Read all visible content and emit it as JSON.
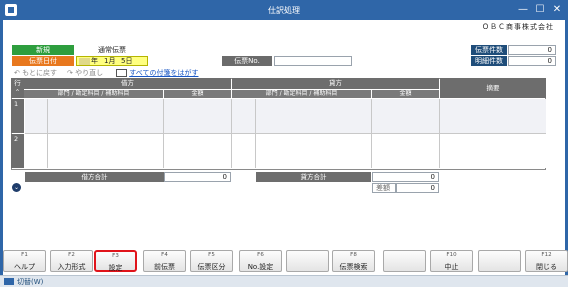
{
  "window": {
    "title": "仕訳処理",
    "minimize": "—",
    "maximize": "☐",
    "close": "✕"
  },
  "company": "ＯＢＣ商事株式会社",
  "form": {
    "mode_label": "新規",
    "mode_value": "通常伝票",
    "date_label": "伝票日付",
    "date_era": "",
    "date_year_suffix": "年",
    "date_month": "1月",
    "date_day": "5日",
    "voucher_no_label": "伝票No.",
    "voucher_no_value": ""
  },
  "counts": {
    "voucher_count_label": "伝票件数",
    "voucher_count_value": "0",
    "detail_count_label": "明細件数",
    "detail_count_value": "0"
  },
  "toolbar": {
    "undo": "もとに戻す",
    "redo": "やり直し",
    "remove_tags": "すべての付箋をはがす"
  },
  "grid": {
    "row_header": "行",
    "debit_header": "借方",
    "credit_header": "貸方",
    "account_sub": "部門 / 勘定科目 / 補助科目",
    "amount_sub": "金額",
    "memo_header": "摘要",
    "rows": [
      "1",
      "2"
    ]
  },
  "totals": {
    "debit_total_label": "借方合計",
    "debit_total_value": "0",
    "credit_total_label": "貸方合計",
    "credit_total_value": "0",
    "diff_label": "差額",
    "diff_value": "0"
  },
  "fkeys": [
    {
      "key": "F1",
      "label": "ヘルプ"
    },
    {
      "key": "F2",
      "label": "入力形式"
    },
    {
      "key": "F3",
      "label": "設定"
    },
    {
      "key": "F4",
      "label": "前伝票"
    },
    {
      "key": "F5",
      "label": "伝票区分"
    },
    {
      "key": "F6",
      "label": "No.設定"
    },
    {
      "key": "",
      "label": ""
    },
    {
      "key": "F8",
      "label": "伝票検索"
    },
    {
      "key": "",
      "label": ""
    },
    {
      "key": "F10",
      "label": "中止"
    },
    {
      "key": "",
      "label": ""
    },
    {
      "key": "F12",
      "label": "閉じる"
    }
  ],
  "status": {
    "switch_label": "切替(W)"
  },
  "colors": {
    "titlebar": "#2f66a8",
    "highlight": "#e0141b",
    "accent_green": "#2e9e3e",
    "accent_orange": "#e8781e"
  }
}
